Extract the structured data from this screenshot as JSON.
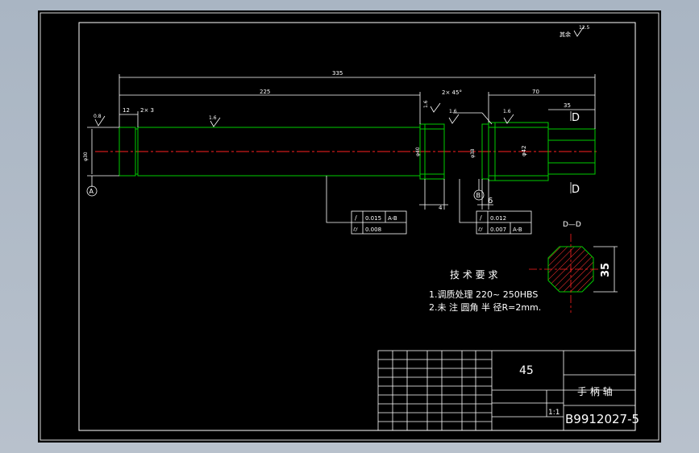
{
  "drawing": {
    "roughness_note": "其余",
    "roughness_note_value": "12.5",
    "dimensions": {
      "overall": "335",
      "main": "225",
      "right_section": "70",
      "flat_length": "35",
      "shoulder": "12",
      "groove_left": "2× 3",
      "chamfer": "2× 45°",
      "gap_b": "4",
      "gap_c": "6",
      "dia_left": "φ30",
      "dia_mid": "φ40",
      "dia_right": "φ42",
      "dia_step": "φ38",
      "section_width": "35"
    },
    "roughness": [
      "0.8",
      "1.6",
      "1.6",
      "1.6",
      "1.6"
    ],
    "datums": [
      "A",
      "B"
    ],
    "section_marks": [
      "D",
      "D"
    ],
    "section_title": "D—D",
    "tolerance_frame_1": [
      {
        "symbol": "/",
        "value": "0.015",
        "datum": "A-B"
      },
      {
        "symbol": "⌭",
        "value": "0.008",
        "datum": ""
      }
    ],
    "tolerance_frame_2": [
      {
        "symbol": "/",
        "value": "0.012",
        "datum": ""
      },
      {
        "symbol": "⌭",
        "value": "0.007",
        "datum": "A-B"
      }
    ],
    "tech_req": {
      "title": "技 术 要 求",
      "line1": "1.调质处理 220~ 250HBS",
      "line2": "2.未 注 圆角 半 径R=2mm."
    },
    "title_block": {
      "material": "45",
      "part_name": "手 柄 轴",
      "scale": "1:1",
      "drawing_no": "B9912027-5"
    }
  },
  "colors": {
    "background": "#000000",
    "outline": "#ffffff",
    "part": "#00cc00",
    "centerline": "#ff2020",
    "hatch": "#ff3030"
  }
}
